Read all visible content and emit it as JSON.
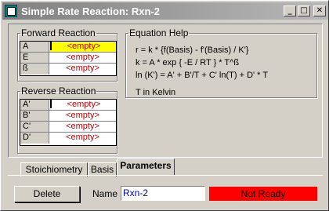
{
  "window": {
    "title": "Simple Rate Reaction: Rxn-2",
    "buttons": {
      "minimize": "_",
      "maximize": "□",
      "close": "✕"
    }
  },
  "forward": {
    "legend": "Forward Reaction",
    "rows": [
      {
        "label": "A",
        "value": "<empty>"
      },
      {
        "label": "E",
        "value": "<empty>"
      },
      {
        "label": "ß",
        "value": "<empty>"
      }
    ]
  },
  "reverse": {
    "legend": "Reverse Reaction",
    "rows": [
      {
        "label": "A'",
        "value": "<empty>"
      },
      {
        "label": "B'",
        "value": "<empty>"
      },
      {
        "label": "C'",
        "value": "<empty>"
      },
      {
        "label": "D'",
        "value": "<empty>"
      }
    ]
  },
  "equation": {
    "legend": "Equation Help",
    "line1": "r  =  k * {f(Basis) - f'(Basis) / K'}",
    "line2": "k  =  A * exp { -E / RT } * T^ß",
    "line3": "ln (K')  =  A' + B'/T + C' ln(T) + D' * T",
    "line4": "T in Kelvin"
  },
  "tabs": [
    {
      "label": "Stoichiometry"
    },
    {
      "label": "Basis"
    },
    {
      "label": "Parameters",
      "active": true
    }
  ],
  "bottom": {
    "delete_label": "Delete",
    "name_label": "Name",
    "name_value": "Rxn-2",
    "status": "Not Ready"
  },
  "colors": {
    "status_bg": "#ff0000",
    "empty_text": "#c00000",
    "selected_cell": "#ffff00",
    "name_text": "#0000c0"
  }
}
